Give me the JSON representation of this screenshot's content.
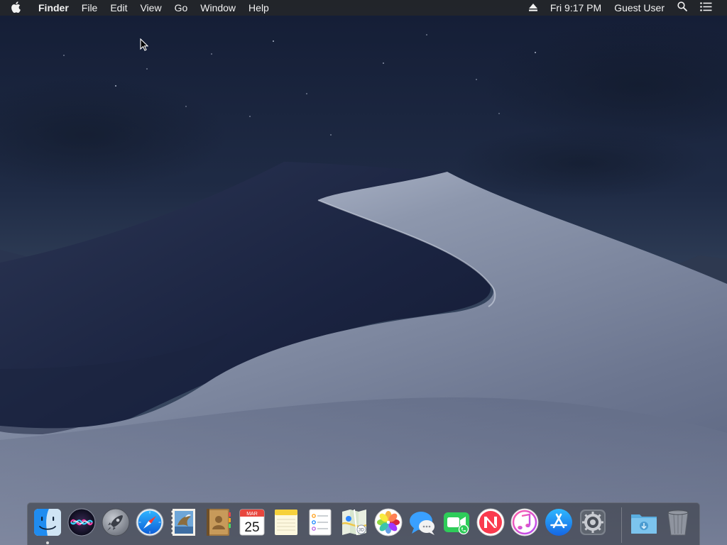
{
  "menubar": {
    "apple_icon": "apple-icon",
    "app_name": "Finder",
    "menus": [
      "File",
      "Edit",
      "View",
      "Go",
      "Window",
      "Help"
    ],
    "status": {
      "eject_icon": "eject-icon",
      "clock": "Fri 9:17 PM",
      "user": "Guest User",
      "spotlight_icon": "search-icon",
      "notification_icon": "list-icon"
    }
  },
  "dock": {
    "apps": [
      {
        "name": "Finder",
        "icon": "finder-icon",
        "running": true
      },
      {
        "name": "Siri",
        "icon": "siri-icon"
      },
      {
        "name": "Launchpad",
        "icon": "rocket-icon"
      },
      {
        "name": "Safari",
        "icon": "compass-icon"
      },
      {
        "name": "Mail",
        "icon": "mail-stamp-icon"
      },
      {
        "name": "Contacts",
        "icon": "contacts-book-icon"
      },
      {
        "name": "Calendar",
        "icon": "calendar-icon",
        "month": "MAR",
        "day": "25"
      },
      {
        "name": "Notes",
        "icon": "notes-icon"
      },
      {
        "name": "Reminders",
        "icon": "reminders-list-icon"
      },
      {
        "name": "Maps",
        "icon": "map-icon"
      },
      {
        "name": "Photos",
        "icon": "photos-flower-icon"
      },
      {
        "name": "Messages",
        "icon": "speech-bubble-icon"
      },
      {
        "name": "FaceTime",
        "icon": "video-camera-icon"
      },
      {
        "name": "News",
        "icon": "news-icon"
      },
      {
        "name": "iTunes",
        "icon": "music-note-icon"
      },
      {
        "name": "App Store",
        "icon": "app-store-icon"
      },
      {
        "name": "System Preferences",
        "icon": "gear-icon"
      }
    ],
    "downloads": {
      "name": "Downloads",
      "icon": "downloads-folder-icon"
    },
    "trash": {
      "name": "Trash",
      "icon": "trash-icon"
    }
  },
  "colors": {
    "menubar_bg": "#24262a",
    "sky_top": "#16203a",
    "sky_bottom": "#3d4d66",
    "dune_light": "#7c859c",
    "dune_shadow": "#1c2540"
  }
}
